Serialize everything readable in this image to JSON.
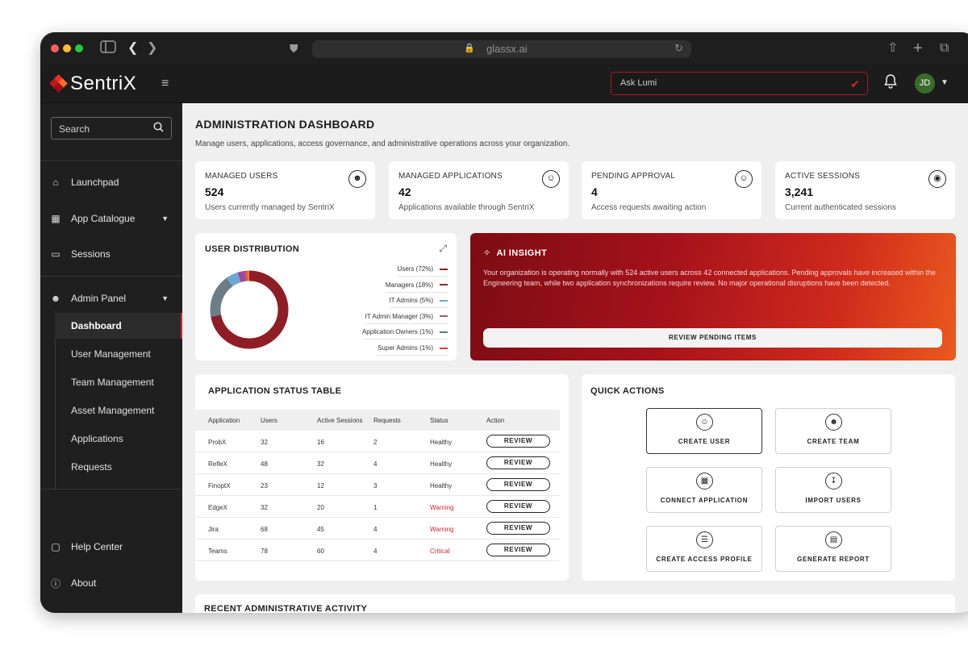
{
  "browser": {
    "url": "glassx.ai",
    "icons": [
      "sidebar-toggle-icon",
      "back-icon",
      "forward-icon",
      "shield-icon",
      "lock-icon",
      "reload-icon",
      "share-icon",
      "new-tab-icon",
      "tabs-icon"
    ]
  },
  "app": {
    "logo_text": "SentriX",
    "ask_placeholder": "Ask Lumi",
    "user_initials": "JD",
    "brand_color": "#d0262e"
  },
  "sidebar": {
    "search_placeholder": "Search",
    "items": [
      {
        "label": "Launchpad",
        "icon": "home-icon"
      },
      {
        "label": "App Catalogue",
        "icon": "grid-icon"
      },
      {
        "label": "Sessions",
        "icon": "laptop-icon"
      },
      {
        "label": "Admin Panel",
        "icon": "users-icon"
      }
    ],
    "admin_sub": [
      {
        "label": "Dashboard"
      },
      {
        "label": "User Management"
      },
      {
        "label": "Team Management"
      },
      {
        "label": "Asset Management"
      },
      {
        "label": "Applications"
      },
      {
        "label": "Requests"
      }
    ],
    "bottom": [
      {
        "label": "Help Center",
        "icon": "book-icon"
      },
      {
        "label": "About",
        "icon": "help-icon"
      }
    ]
  },
  "page": {
    "title": "ADMINISTRATION DASHBOARD",
    "subtitle": "Manage users, applications, access governance, and administrative operations across your organization."
  },
  "stats": [
    {
      "title": "MANAGED USERS",
      "value": "524",
      "desc": "Users currently managed by SentriX",
      "icon": "users-icon"
    },
    {
      "title": "MANAGED APPLICATIONS",
      "value": "42",
      "desc": "Applications available through SentriX",
      "icon": "user-icon"
    },
    {
      "title": "PENDING APPROVAL",
      "value": "4",
      "desc": "Access requests awaiting action",
      "icon": "user-icon"
    },
    {
      "title": "ACTIVE SESSIONS",
      "value": "3,241",
      "desc": "Current authenticated sessions",
      "icon": "fingerprint-icon"
    }
  ],
  "distribution": {
    "title": "USER DISTRIBUTION",
    "legend": [
      {
        "label": "Users (72%)",
        "color": "#8f1d25"
      },
      {
        "label": "Managers (18%)",
        "color": "#8a2c33"
      },
      {
        "label": "IT Admins (5%)",
        "color": "#6aa8d6"
      },
      {
        "label": "IT Admin Manager (3%)",
        "color": "#8a6a6e"
      },
      {
        "label": "Application Owners (1%)",
        "color": "#5d7880"
      },
      {
        "label": "Super Admins (1%)",
        "color": "#d63a3a"
      }
    ]
  },
  "chart_data": {
    "type": "pie",
    "title": "USER DISTRIBUTION",
    "categories": [
      "Users",
      "Managers",
      "IT Admins",
      "IT Admin Manager",
      "Application Owners",
      "Super Admins"
    ],
    "values": [
      72,
      18,
      5,
      3,
      1,
      1
    ],
    "legend_position": "right"
  },
  "insight": {
    "title": "AI INSIGHT",
    "text": "Your organization is operating normally with 524 active users across 42 connected applications. Pending approvals have increased within the Engineering team, while two application synchronizations require review. No major operational disruptions have been detected.",
    "button": "REVIEW PENDING ITEMS"
  },
  "app_table": {
    "title": "APPLICATION STATUS TABLE",
    "columns": [
      "Application",
      "Users",
      "Active Sessions",
      "Requests",
      "Status",
      "Action"
    ],
    "rows": [
      {
        "app": "ProbX",
        "users": "32",
        "sessions": "16",
        "requests": "2",
        "status": "Healthy",
        "action": "REVIEW"
      },
      {
        "app": "RefleX",
        "users": "48",
        "sessions": "32",
        "requests": "4",
        "status": "Healthy",
        "action": "REVIEW"
      },
      {
        "app": "FinoptX",
        "users": "23",
        "sessions": "12",
        "requests": "3",
        "status": "Healthy",
        "action": "REVIEW"
      },
      {
        "app": "EdgeX",
        "users": "32",
        "sessions": "20",
        "requests": "1",
        "status": "Warning",
        "action": "REVIEW"
      },
      {
        "app": "Jira",
        "users": "68",
        "sessions": "45",
        "requests": "4",
        "status": "Warning",
        "action": "REVIEW"
      },
      {
        "app": "Teams",
        "users": "78",
        "sessions": "60",
        "requests": "4",
        "status": "Critical",
        "action": "REVIEW"
      }
    ],
    "status_colors": {
      "Healthy": "#333333",
      "Warning": "#d0262e",
      "Critical": "#d0262e"
    }
  },
  "quick_actions": {
    "title": "QUICK ACTIONS",
    "buttons": [
      {
        "label": "CREATE USER",
        "icon": "user-plus-icon"
      },
      {
        "label": "CREATE TEAM",
        "icon": "users-icon"
      },
      {
        "label": "CONNECT APPLICATION",
        "icon": "apps-icon"
      },
      {
        "label": "IMPORT USERS",
        "icon": "download-icon"
      },
      {
        "label": "CREATE ACCESS PROFILE",
        "icon": "list-icon"
      },
      {
        "label": "GENERATE REPORT",
        "icon": "report-icon"
      }
    ]
  },
  "recent": {
    "title": "RECENT ADMINISTRATIVE ACTIVITY"
  }
}
